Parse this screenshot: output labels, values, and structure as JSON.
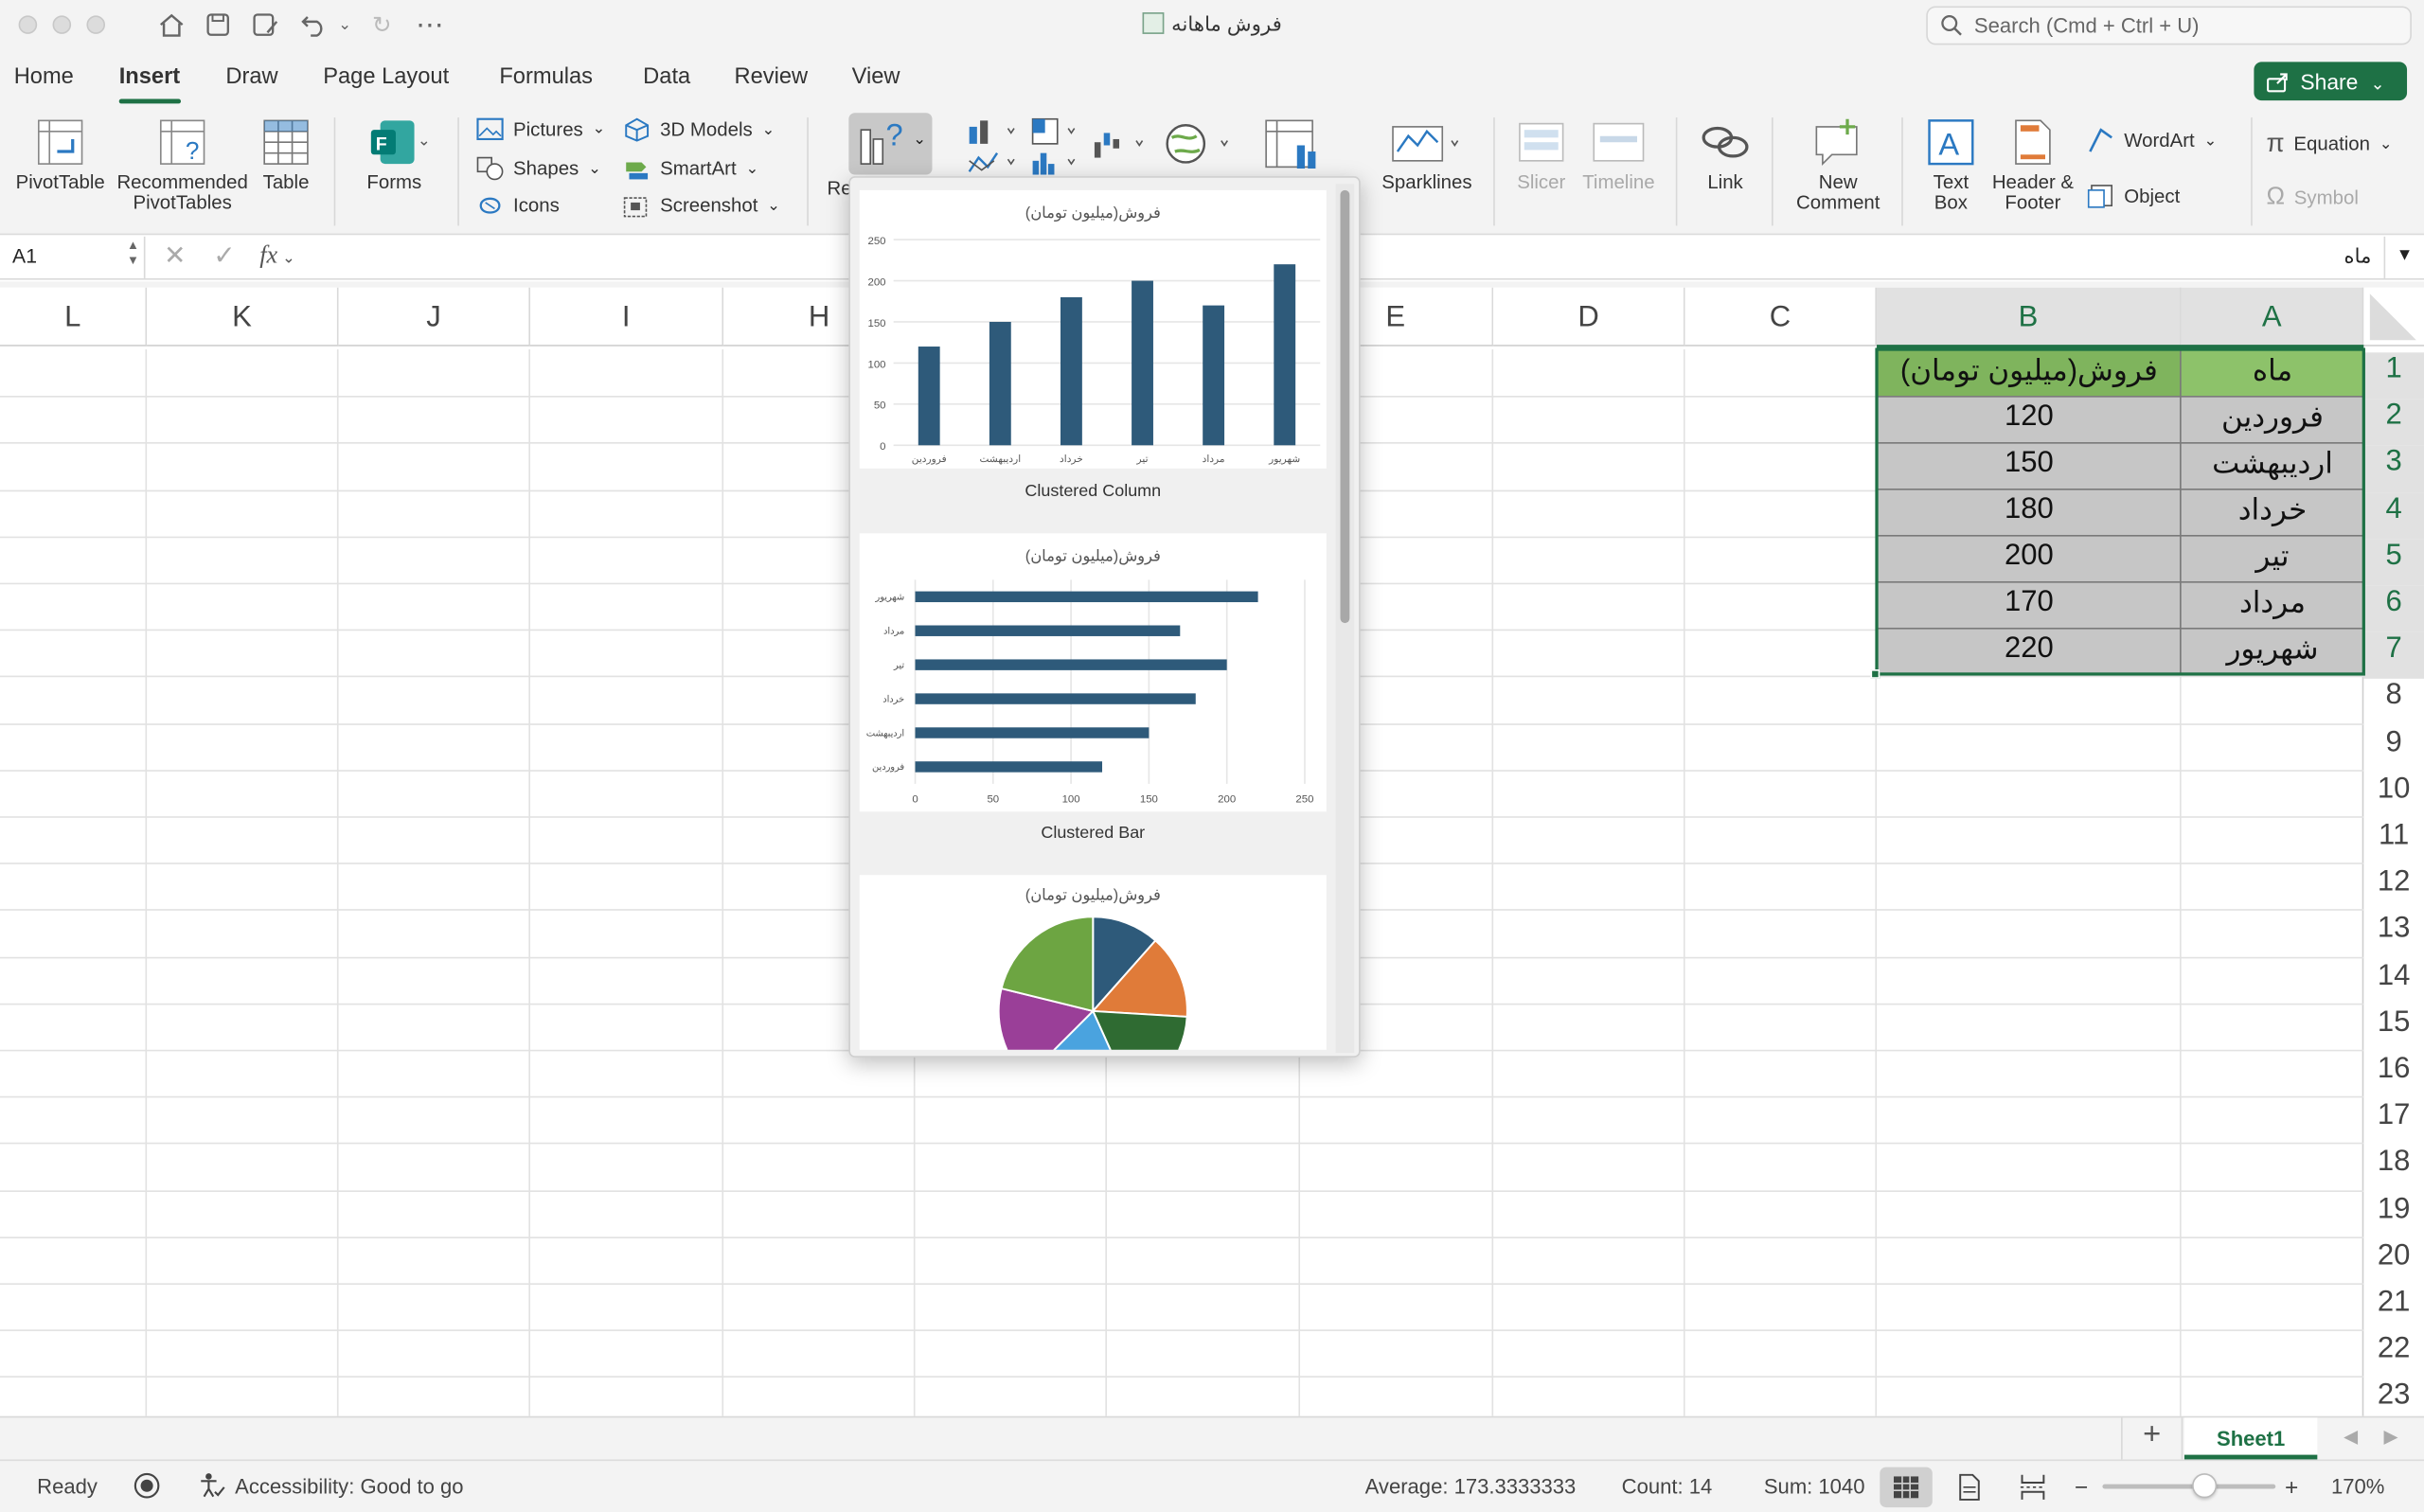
{
  "window": {
    "title": "فروش ماهانه"
  },
  "search": {
    "placeholder": "Search (Cmd + Ctrl + U)"
  },
  "tabs": [
    "Home",
    "Insert",
    "Draw",
    "Page Layout",
    "Formulas",
    "Data",
    "Review",
    "View"
  ],
  "share_label": "Share",
  "ribbon": {
    "pivottable": "PivotTable",
    "recommended_1": "Recommended",
    "recommended_2": "PivotTables",
    "table": "Table",
    "forms": "Forms",
    "pictures": "Pictures",
    "shapes": "Shapes",
    "icons": "Icons",
    "models3d": "3D Models",
    "smartart": "SmartArt",
    "screenshot": "Screenshot",
    "rec_charts_truncated": "Re",
    "sparklines": "Sparklines",
    "slicer": "Slicer",
    "timeline": "Timeline",
    "link": "Link",
    "new_comment_1": "New",
    "new_comment_2": "Comment",
    "textbox_1": "Text",
    "textbox_2": "Box",
    "header_1": "Header &",
    "header_2": "Footer",
    "wordart": "WordArt",
    "object": "Object",
    "equation": "Equation",
    "symbol": "Symbol"
  },
  "formula_bar": {
    "name_box": "A1",
    "fx": "fx",
    "value": "ماه"
  },
  "columns": [
    "L",
    "K",
    "J",
    "I",
    "H",
    "E",
    "D",
    "C",
    "B",
    "A"
  ],
  "rows": [
    "1",
    "2",
    "3",
    "4",
    "5",
    "6",
    "7",
    "8",
    "9",
    "10",
    "11",
    "12",
    "13",
    "14",
    "15",
    "16",
    "17",
    "18",
    "19",
    "20",
    "21",
    "22",
    "23"
  ],
  "table": {
    "header_month": "ماه",
    "header_sales": "فروش(میلیون تومان)",
    "months": [
      "فروردین",
      "اردیبهشت",
      "خرداد",
      "تیر",
      "مرداد",
      "شهریور"
    ],
    "sales": [
      "120",
      "150",
      "180",
      "200",
      "170",
      "220"
    ]
  },
  "chart_gallery": {
    "labels": [
      "Clustered Column",
      "Clustered Bar"
    ],
    "title": "فروش(میلیون تومان)",
    "bar_color": "#2e5a7a",
    "pie_colors": [
      "#2e5a7a",
      "#e07b39",
      "#2f6b32",
      "#4aa3df",
      "#9a3f98",
      "#6da542"
    ]
  },
  "chart_data": [
    {
      "type": "bar",
      "title": "فروش(میلیون تومان)",
      "categories": [
        "فروردین",
        "اردیبهشت",
        "خرداد",
        "تیر",
        "مرداد",
        "شهریور"
      ],
      "values": [
        120,
        150,
        180,
        200,
        170,
        220
      ],
      "ylim": [
        0,
        250
      ],
      "yticks": [
        "0",
        "50",
        "100",
        "150",
        "200",
        "250"
      ]
    },
    {
      "type": "bar",
      "orientation": "horizontal",
      "title": "فروش(میلیون تومان)",
      "categories": [
        "فروردین",
        "اردیبهشت",
        "خرداد",
        "تیر",
        "مرداد",
        "شهریور"
      ],
      "values": [
        120,
        150,
        180,
        200,
        170,
        220
      ],
      "xlim": [
        0,
        250
      ],
      "xticks": [
        "0",
        "50",
        "100",
        "150",
        "200",
        "250"
      ]
    },
    {
      "type": "pie",
      "title": "فروش(میلیون تومان)",
      "categories": [
        "فروردین",
        "اردیبهشت",
        "خرداد",
        "تیر",
        "مرداد",
        "شهریور"
      ],
      "values": [
        120,
        150,
        180,
        200,
        170,
        220
      ]
    }
  ],
  "sheet": {
    "add": "+",
    "name": "Sheet1"
  },
  "status": {
    "ready": "Ready",
    "accessibility": "Accessibility: Good to go",
    "average": "Average: 173.3333333",
    "count": "Count: 14",
    "sum": "Sum: 1040",
    "zoom": "170%"
  }
}
